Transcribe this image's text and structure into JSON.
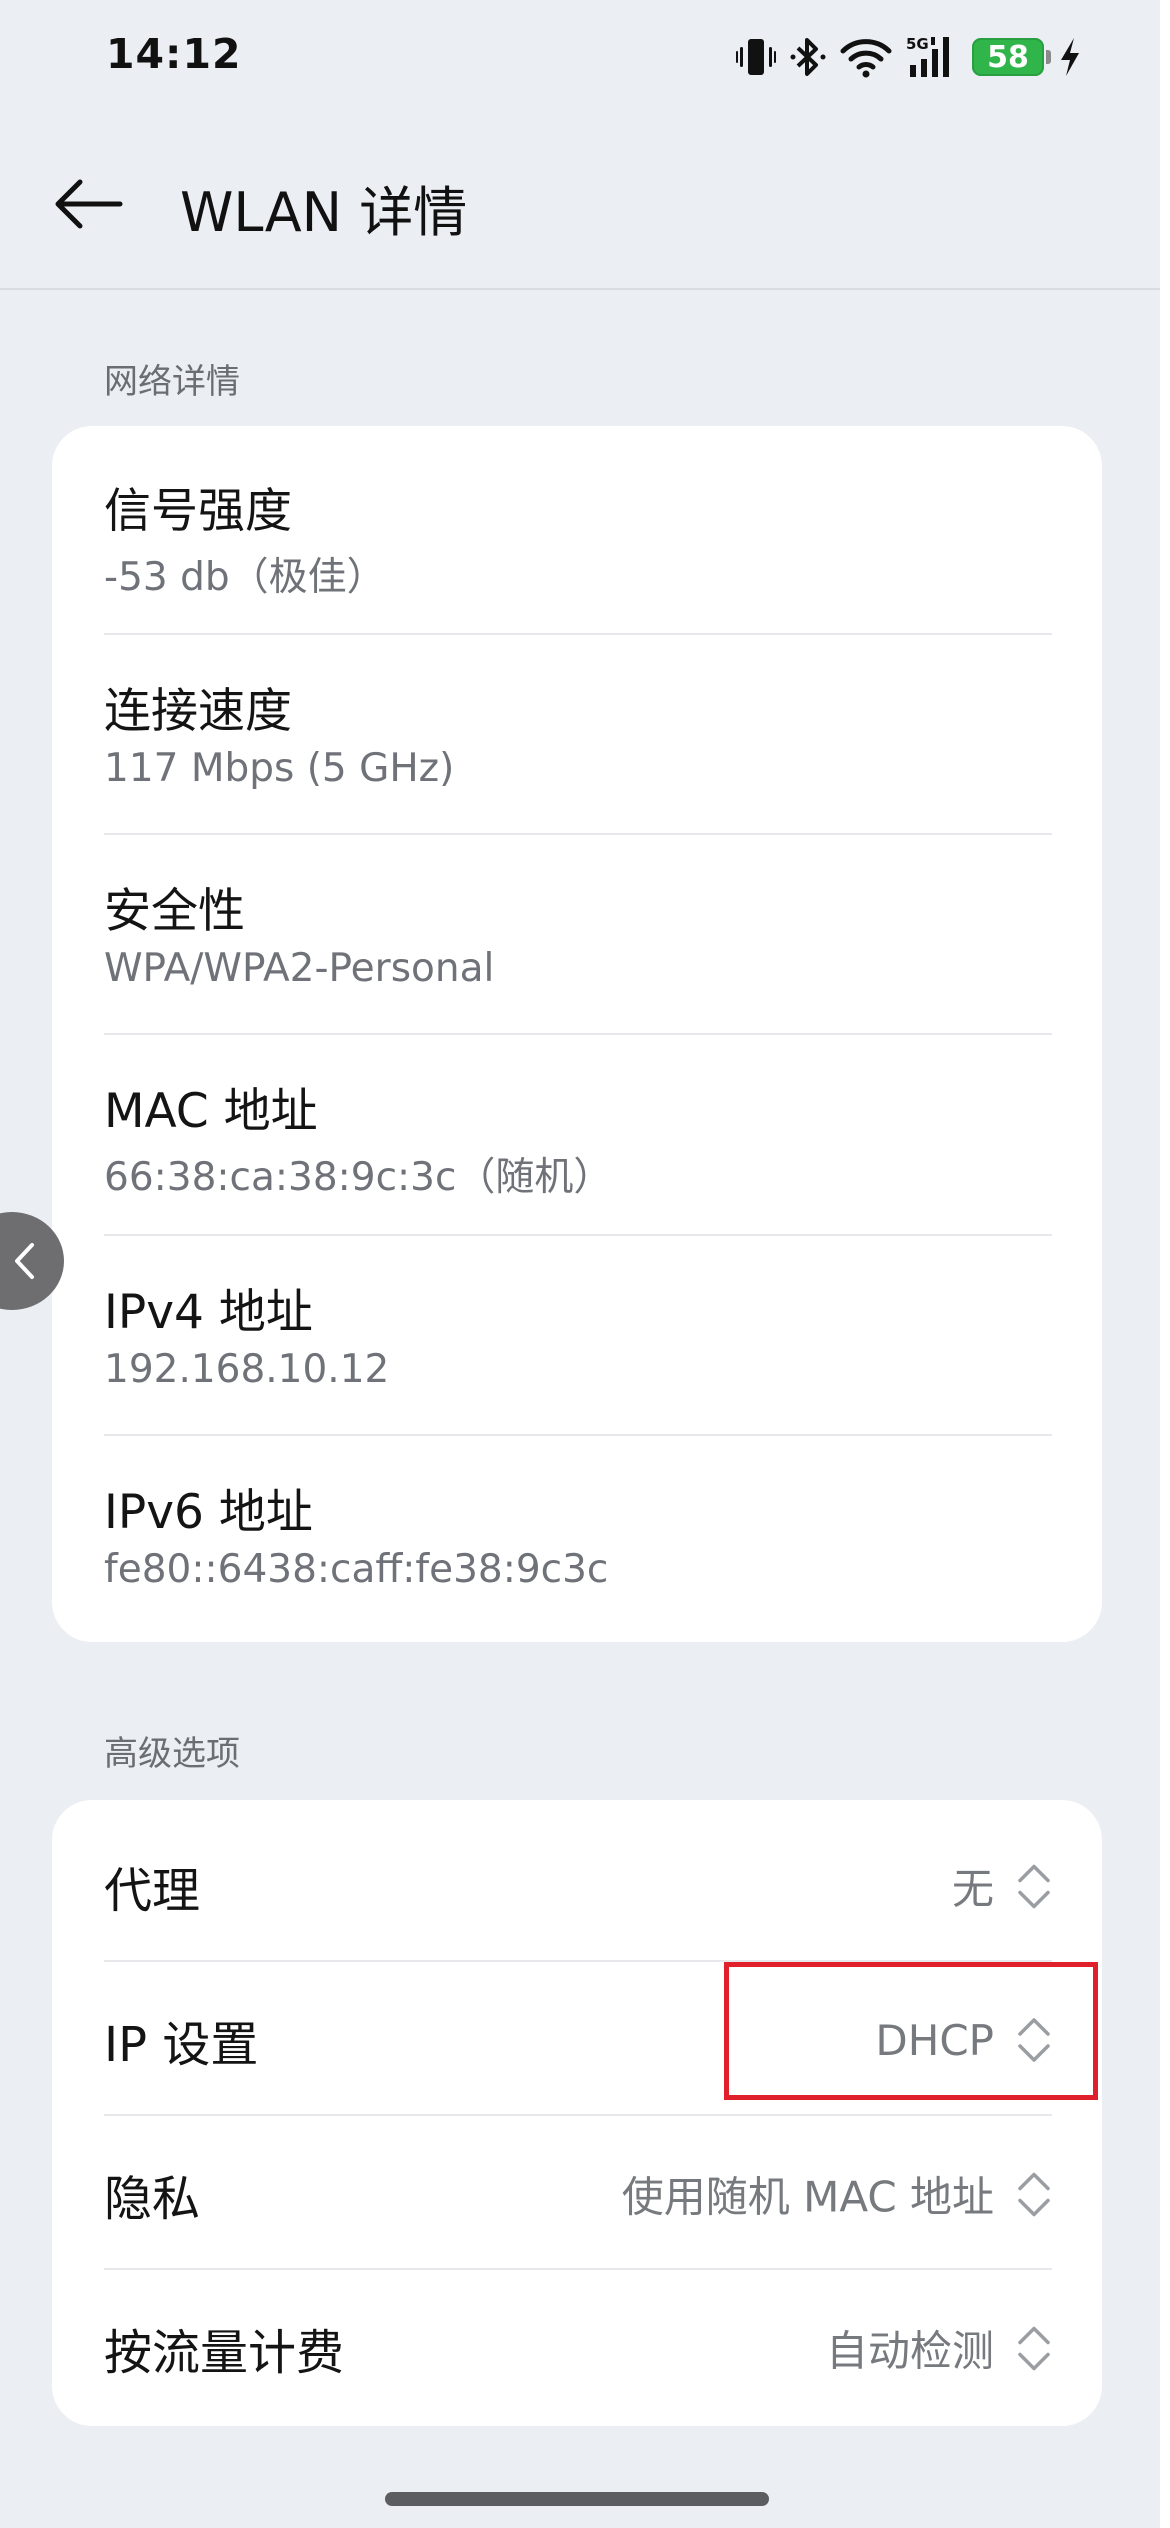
{
  "status_bar": {
    "time": "14:12",
    "icons": [
      "vibrate-icon",
      "bluetooth-icon",
      "wifi-icon",
      "5g-signal-icon",
      "battery-icon",
      "charging-icon"
    ],
    "network": "5G",
    "battery": "58"
  },
  "header": {
    "title": "WLAN 详情"
  },
  "network_details": {
    "section_label": "网络详情",
    "items": [
      {
        "title": "信号强度",
        "value": "-53 db（极佳）"
      },
      {
        "title": "连接速度",
        "value": "117 Mbps (5 GHz)"
      },
      {
        "title": "安全性",
        "value": "WPA/WPA2-Personal"
      },
      {
        "title": "MAC 地址",
        "value": "66:38:ca:38:9c:3c（随机）"
      },
      {
        "title": "IPv4 地址",
        "value": "192.168.10.12"
      },
      {
        "title": "IPv6 地址",
        "value": "fe80::6438:caff:fe38:9c3c"
      }
    ]
  },
  "advanced": {
    "section_label": "高级选项",
    "items": [
      {
        "title": "代理",
        "value": "无"
      },
      {
        "title": "IP 设置",
        "value": "DHCP"
      },
      {
        "title": "隐私",
        "value": "使用随机 MAC 地址"
      },
      {
        "title": "按流量计费",
        "value": "自动检测"
      }
    ]
  },
  "colors": {
    "background": "#ebeef2",
    "card": "#ffffff",
    "highlight": "#e0202b",
    "battery": "#2fb54a"
  }
}
